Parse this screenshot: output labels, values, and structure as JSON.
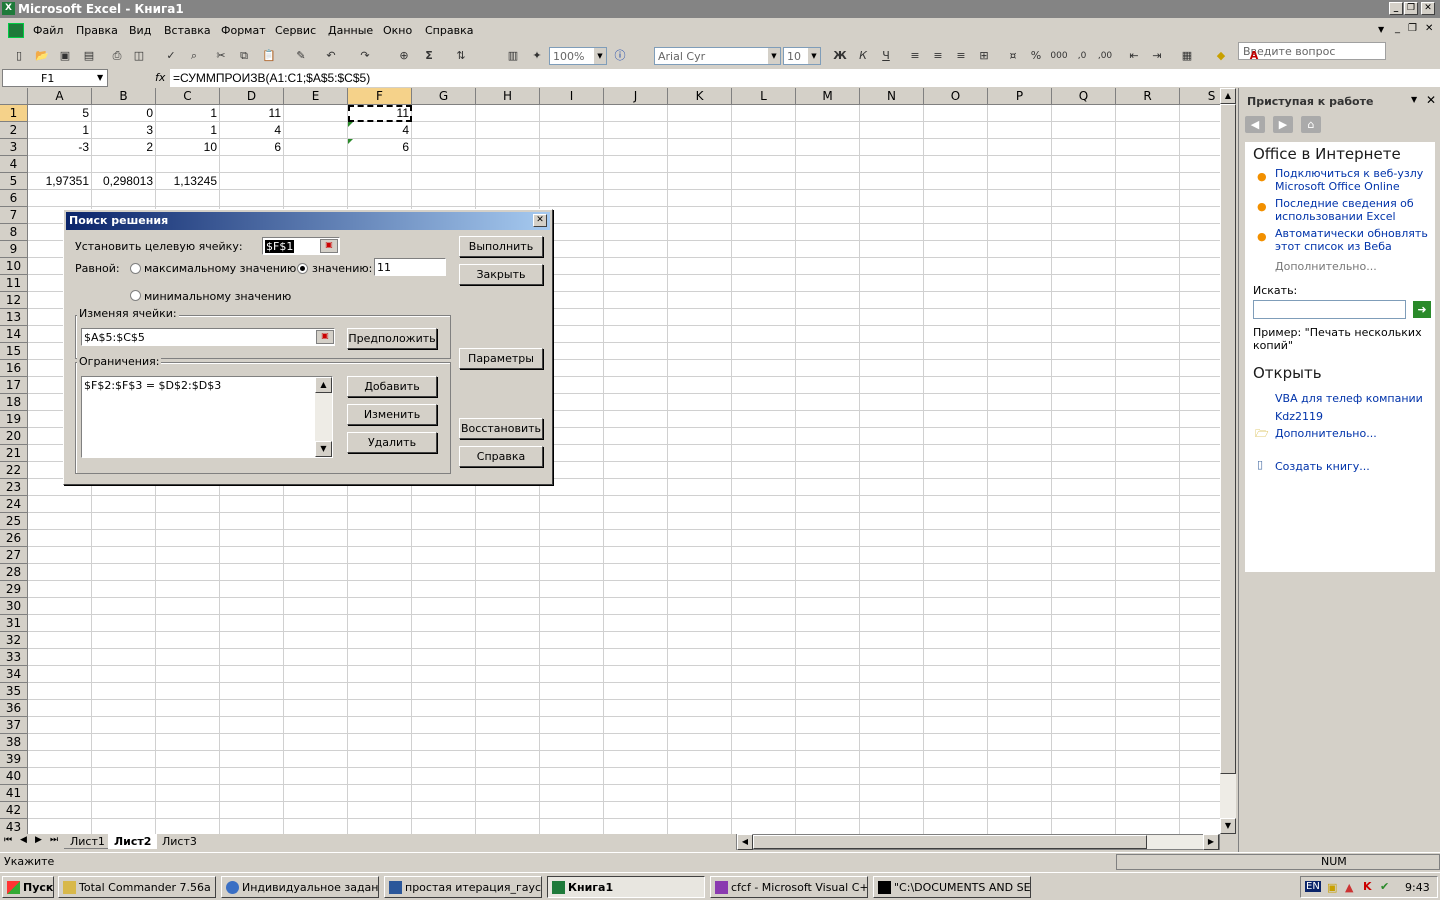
{
  "window": {
    "title": "Microsoft Excel - Книга1"
  },
  "menu": [
    "Файл",
    "Правка",
    "Вид",
    "Вставка",
    "Формат",
    "Сервис",
    "Данные",
    "Окно",
    "Справка"
  ],
  "ask_placeholder": "Введите вопрос",
  "toolbar": {
    "zoom": "100%",
    "font": "Arial Cyr",
    "size": "10",
    "bold": "Ж",
    "italic": "К",
    "underline": "Ч"
  },
  "formula_bar": {
    "name": "F1",
    "fx": "fx",
    "formula": "=СУММПРОИЗВ(A1:C1;$A$5:$C$5)"
  },
  "columns": [
    "A",
    "B",
    "C",
    "D",
    "E",
    "F",
    "G",
    "H",
    "I",
    "J",
    "K",
    "L",
    "M",
    "N",
    "O",
    "P",
    "Q",
    "R",
    "S"
  ],
  "rows": [
    "1",
    "2",
    "3",
    "4",
    "5",
    "6",
    "7",
    "8",
    "9",
    "10",
    "11",
    "12",
    "13",
    "14",
    "15",
    "16",
    "17",
    "18",
    "19",
    "20",
    "21",
    "22",
    "23",
    "24",
    "25",
    "26",
    "27",
    "28",
    "29",
    "30",
    "31",
    "32",
    "33",
    "34",
    "35",
    "36",
    "37",
    "38",
    "39",
    "40",
    "41",
    "42",
    "43"
  ],
  "cells": {
    "r1": [
      "5",
      "0",
      "1",
      "11",
      "",
      "11"
    ],
    "r2": [
      "1",
      "3",
      "1",
      "4",
      "",
      "4"
    ],
    "r3": [
      "-3",
      "2",
      "10",
      "6",
      "",
      "6"
    ],
    "r5": [
      "1,97351",
      "0,298013",
      "1,13245"
    ]
  },
  "sheets": [
    "Лист1",
    "Лист2",
    "Лист3"
  ],
  "status": {
    "mode": "Укажите",
    "num": "NUM"
  },
  "dialog": {
    "title": "Поиск решения",
    "target_label": "Установить целевую ячейку:",
    "target_value": "$F$1",
    "equal_label": "Равной:",
    "opt_max": "максимальному значению",
    "opt_value": "значению:",
    "value": "11",
    "opt_min": "минимальному значению",
    "changing_label": "Изменяя ячейки:",
    "changing_value": "$A$5:$C$5",
    "constraints_label": "Ограничения:",
    "constraint_1": "$F$2:$F$3 = $D$2:$D$3",
    "btn_run": "Выполнить",
    "btn_close": "Закрыть",
    "btn_guess": "Предположить",
    "btn_params": "Параметры",
    "btn_add": "Добавить",
    "btn_change": "Изменить",
    "btn_delete": "Удалить",
    "btn_reset": "Восстановить",
    "btn_help": "Справка"
  },
  "taskpane": {
    "title": "Приступая к работе",
    "office_header": "Office в Интернете",
    "link1": "Подключиться к веб-узлу Microsoft Office Online",
    "link2": "Последние сведения об использовании Excel",
    "link3": "Автоматически обновлять этот список из Веба",
    "more1": "Дополнительно...",
    "search_label": "Искать:",
    "example": "Пример: \"Печать нескольких копий\"",
    "open_header": "Открыть",
    "file1": "VBA для телеф компании",
    "file2": "Kdz2119",
    "more2": "Дополнительно...",
    "create": "Создать книгу..."
  },
  "taskbar": {
    "start": "Пуск",
    "items": [
      "Total Commander 7.56a ...",
      "Индивидуальное задан...",
      "простая итерация_гаус...",
      "Книга1",
      "cfcf - Microsoft Visual C+...",
      "\"C:\\DOCUMENTS AND SE..."
    ],
    "lang": "EN",
    "time": "9:43"
  }
}
